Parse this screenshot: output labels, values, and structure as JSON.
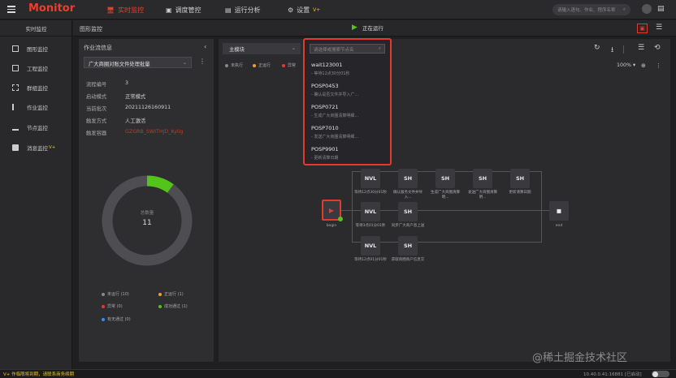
{
  "app": {
    "title": "Monitor",
    "menu_icon": "hamburger-icon"
  },
  "nav": {
    "tabs": [
      {
        "label": "实时监控",
        "icon": "monitor-icon"
      },
      {
        "label": "调度管控",
        "icon": "schedule-icon"
      },
      {
        "label": "运行分析",
        "icon": "analysis-icon"
      },
      {
        "label": "设置",
        "badge": "V+",
        "icon": "gear-icon"
      }
    ]
  },
  "search": {
    "placeholder": "请输入语句、作业、程序名称"
  },
  "sidebar": {
    "header": "实时监控",
    "items": [
      {
        "label": "图形监控"
      },
      {
        "label": "工程监控"
      },
      {
        "label": "群组监控"
      },
      {
        "label": "作业监控"
      },
      {
        "label": "节点监控"
      },
      {
        "label": "消息监控",
        "badge": "V+"
      }
    ]
  },
  "subheader": {
    "title": "图形监控",
    "status": "正在运行"
  },
  "workflow": {
    "header": "作业流信息",
    "selected": "广大商圈对账文件处理批量",
    "fields": [
      {
        "k": "流程编号",
        "v": "3"
      },
      {
        "k": "启动模式",
        "v": "正常模式"
      },
      {
        "k": "当前批次",
        "v": "20211126160911"
      },
      {
        "k": "触发方式",
        "v": "人工激活"
      },
      {
        "k": "触发容器",
        "v": "GZGRB_SWITHJD_Kylig"
      }
    ],
    "donut": {
      "label": "总数量",
      "total": "11",
      "fraction": 0.1
    },
    "legend": [
      {
        "label": "未运行 (10)",
        "color": "#888888"
      },
      {
        "label": "正运行 (1)",
        "color": "#f0a030"
      },
      {
        "label": "异常 (0)",
        "color": "#e03b2f"
      },
      {
        "label": "成功通过 (1)",
        "color": "#52c41a"
      },
      {
        "label": "有无通过 (0)",
        "color": "#3a8ee6"
      }
    ]
  },
  "canvas": {
    "module": "主模块",
    "search_placeholder": "请选择或搜索节点名",
    "zoom": "100%",
    "legend": [
      {
        "label": "未执行",
        "color": "#888888"
      },
      {
        "label": "正运行",
        "color": "#f0a030"
      },
      {
        "label": "异常",
        "color": "#e03b2f"
      }
    ],
    "nodes": {
      "begin": "begin",
      "end": "end",
      "play": "▶",
      "stop": "■",
      "n1": {
        "type": "NVL",
        "label": "等待12点30分01秒"
      },
      "n2": {
        "type": "SH",
        "label": "确认服务文件并导入..."
      },
      "n3": {
        "type": "SH",
        "label": "生成广大商圈清算明..."
      },
      "n4": {
        "type": "SH",
        "label": "发送广大商圈清算明..."
      },
      "n5": {
        "type": "SH",
        "label": "更新清算日期"
      },
      "n6": {
        "type": "NVL",
        "label": "等待3点01分01秒"
      },
      "n7": {
        "type": "SH",
        "label": "同步广大商户息上送"
      },
      "n8": {
        "type": "NVL",
        "label": "等待12点01分01秒"
      },
      "n9": {
        "type": "SH",
        "label": "获取商圈商户信息交"
      }
    }
  },
  "dropdown": {
    "items": [
      {
        "title": "wait123001",
        "sub": "- 等待12点30分01秒"
      },
      {
        "title": "POSP0453",
        "sub": "- 确认是否文件并导入广..."
      },
      {
        "title": "POSP0721",
        "sub": "- 生成广大商圈清算明细..."
      },
      {
        "title": "POSP7010",
        "sub": "- 发送广大商圈清算明细..."
      },
      {
        "title": "POSP9901",
        "sub": "- 更新清算日期"
      }
    ]
  },
  "footer": {
    "left": "V+ 作临限将到期，请联系商务续期",
    "right": "10.40.0.41:16881  [已启动]"
  },
  "watermark": "@稀土掘金技术社区"
}
